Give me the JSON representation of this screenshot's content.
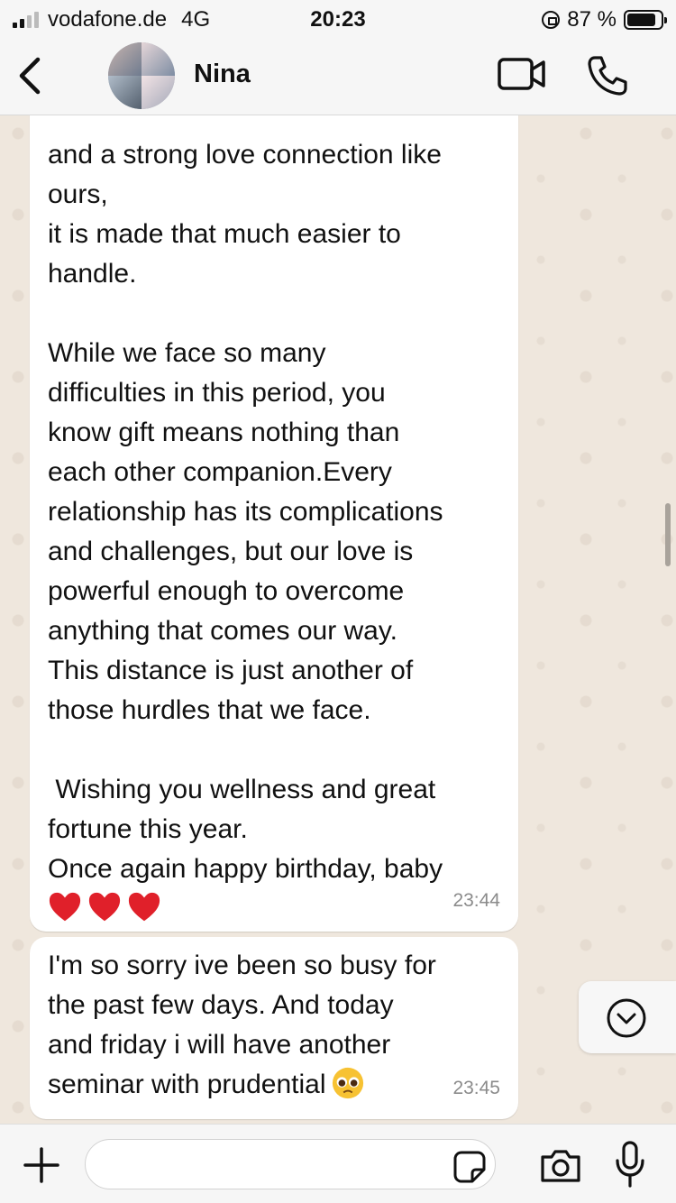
{
  "status_bar": {
    "carrier": "vodafone.de",
    "network": "4G",
    "time": "20:23",
    "battery": "87 %",
    "battery_level": 0.87
  },
  "header": {
    "contact_name": "Nina",
    "back_icon": "chevron-left-icon",
    "video_icon": "video-call-icon",
    "call_icon": "phone-icon"
  },
  "messages": [
    {
      "text": "and a strong love connection like\nours,\nit is made that much easier to\nhandle.\n\nWhile we face so many\ndifficulties in this period, you\nknow gift means nothing than\neach other companion.Every\nrelationship has its complications\nand challenges, but our love is\npowerful enough to overcome\nanything that comes our way.\nThis distance is just another of\nthose hurdles that we face.\n\n Wishing you wellness and great\nfortune this year.\nOnce again happy birthday, baby",
      "emoji": "❤️❤️❤️",
      "time": "23:44"
    },
    {
      "text": "I'm so sorry ive been so busy for\nthe past few days. And today\nand friday i will have another\nseminar with prudential",
      "emoji": "🥺",
      "time": "23:45"
    }
  ],
  "input": {
    "placeholder": "",
    "value": ""
  },
  "colors": {
    "chat_background": "#efe7dd",
    "bubble": "#ffffff",
    "bar": "#f6f6f6",
    "timestamp": "#8b8b8b"
  }
}
